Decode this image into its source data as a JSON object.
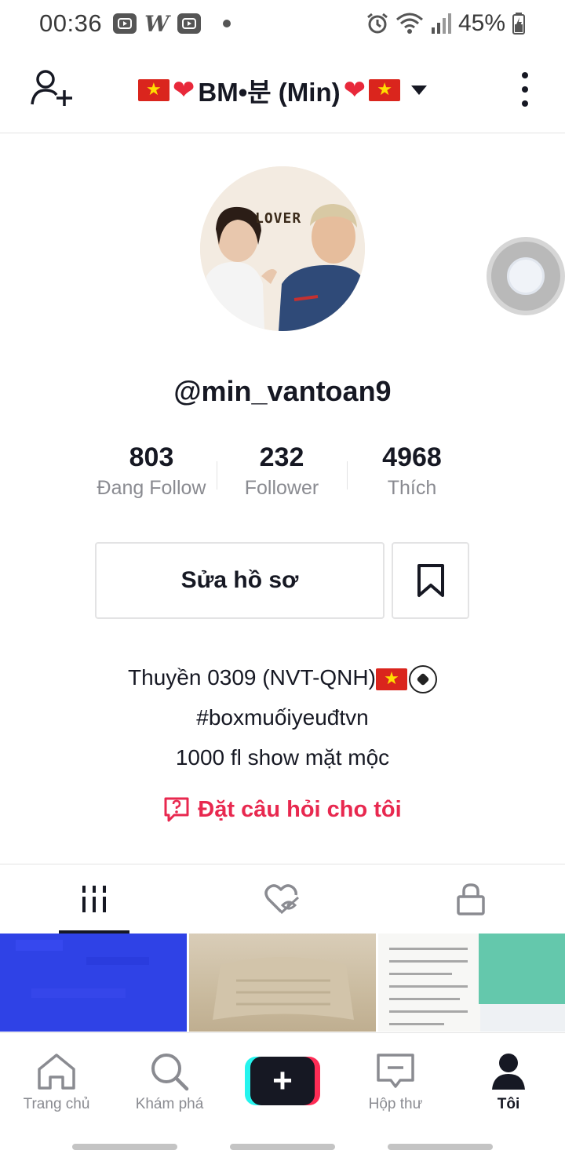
{
  "status_bar": {
    "time": "00:36",
    "battery": "45%",
    "icons": [
      "youtube-icon",
      "w-app-icon",
      "youtube-icon",
      "notification-dot",
      "alarm-icon",
      "wifi-icon",
      "signal-icon",
      "battery-icon"
    ],
    "w_letter": "W"
  },
  "header": {
    "account_name": "BM•분 (Min)"
  },
  "avatar": {
    "overlay_text": "LOVER"
  },
  "profile": {
    "username": "@min_vantoan9",
    "stats": [
      {
        "value": "803",
        "label": "Đang Follow"
      },
      {
        "value": "232",
        "label": "Follower"
      },
      {
        "value": "4968",
        "label": "Thích"
      }
    ],
    "edit_label": "Sửa hồ sơ",
    "bio": {
      "line1": "Thuyền 0309 (NVT-QNH)",
      "line2": "#boxmuốiyeuđtvn",
      "line3": "1000 fl show mặt mộc"
    },
    "ask_label": "Đặt câu hỏi cho tôi"
  },
  "tabs": [
    "videos-grid",
    "liked-hidden",
    "private-lock"
  ],
  "bottom_nav": {
    "items": [
      {
        "label": "Trang chủ",
        "icon": "home-icon"
      },
      {
        "label": "Khám phá",
        "icon": "search-icon"
      },
      {
        "label": "",
        "icon": "plus-icon"
      },
      {
        "label": "Hộp thư",
        "icon": "inbox-icon"
      },
      {
        "label": "Tôi",
        "icon": "profile-icon"
      }
    ]
  },
  "colors": {
    "accent": "#fe2c55",
    "ask_link": "#e8284f",
    "text": "#161823",
    "muted": "#8a8b91"
  }
}
